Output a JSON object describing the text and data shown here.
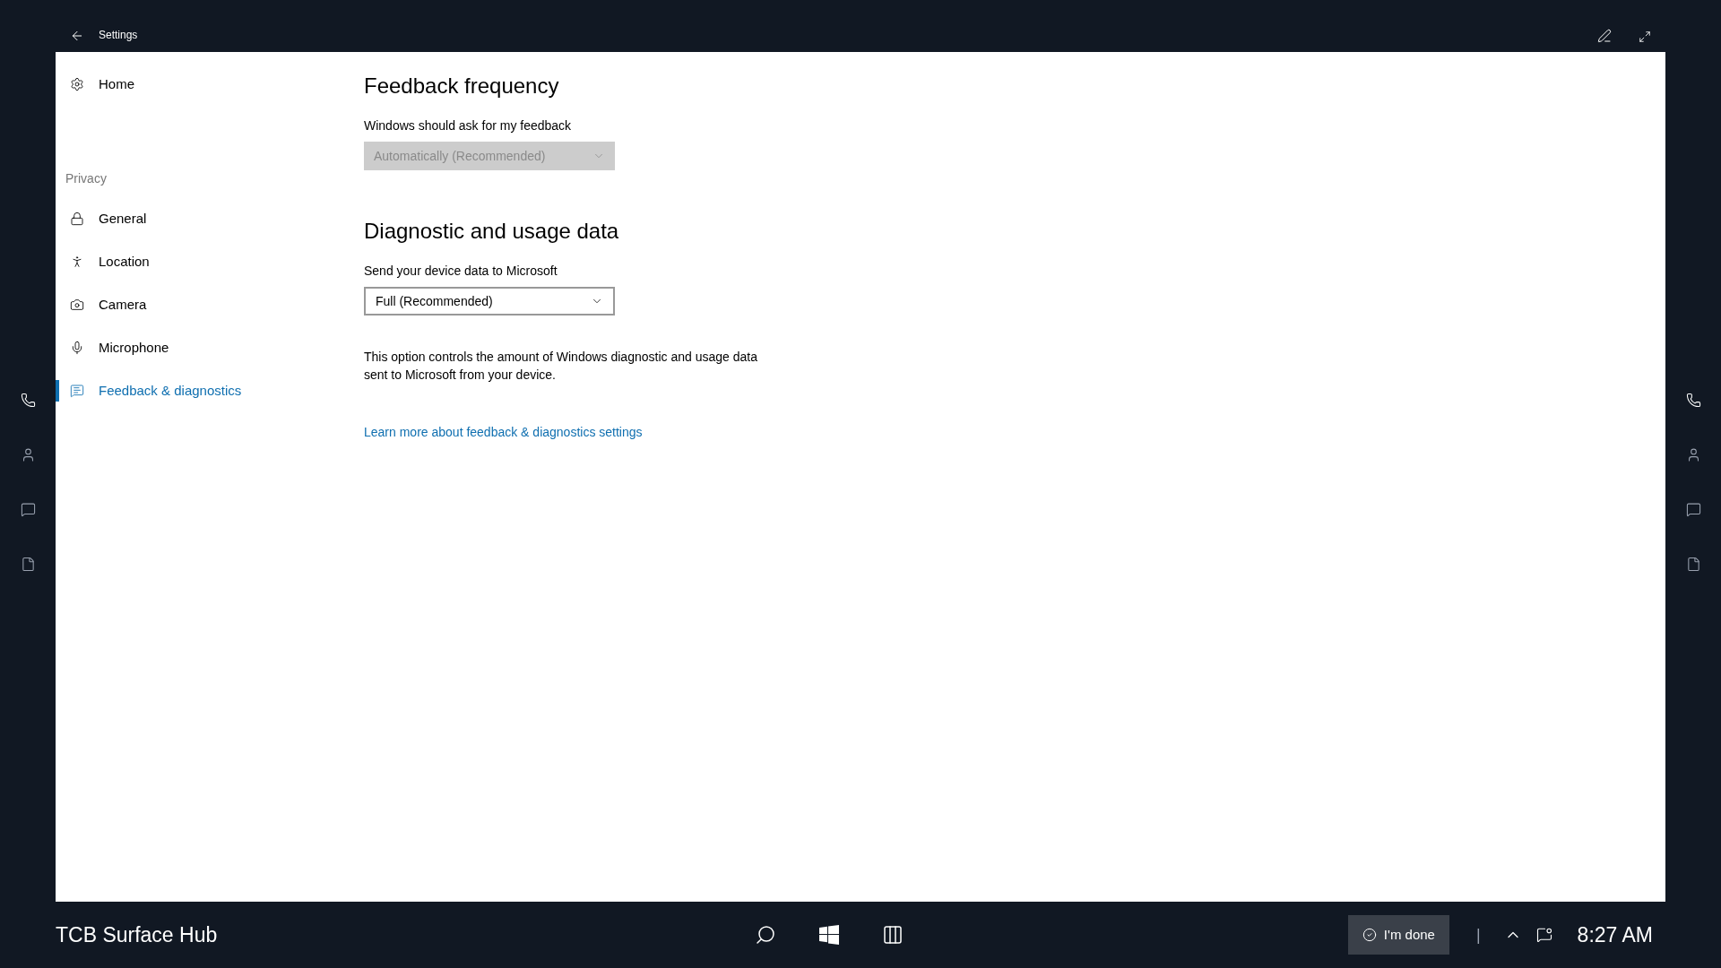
{
  "window": {
    "title": "Settings"
  },
  "sidebar": {
    "home": "Home",
    "section": "Privacy",
    "items": [
      {
        "label": "General",
        "selected": false
      },
      {
        "label": "Location",
        "selected": false
      },
      {
        "label": "Camera",
        "selected": false
      },
      {
        "label": "Microphone",
        "selected": false
      },
      {
        "label": "Feedback & diagnostics",
        "selected": true
      }
    ]
  },
  "sections": [
    {
      "heading": "Feedback frequency",
      "label": "Windows should ask for my feedback",
      "dropdown": {
        "value": "Automatically (Recommended)",
        "disabled": true
      }
    },
    {
      "heading": "Diagnostic and usage data",
      "label": "Send your device data to Microsoft",
      "dropdown": {
        "value": "Full (Recommended)",
        "disabled": false
      },
      "description": "This option controls the amount of Windows diagnostic and usage data sent to Microsoft from your device.",
      "link": "Learn more about feedback & diagnostics settings"
    }
  ],
  "taskbar": {
    "device_name": "TCB Surface Hub",
    "done_button": "I'm done",
    "separator": "|",
    "time": "8:27 AM"
  }
}
